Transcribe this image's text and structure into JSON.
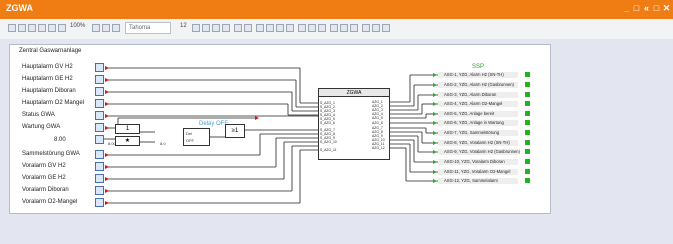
{
  "window": {
    "title": "ZGWA",
    "controls": [
      "_",
      "□",
      "«",
      "□",
      "✕"
    ]
  },
  "toolbar": {
    "zoom": "100%",
    "font": "Tahoma",
    "font_size": "12"
  },
  "diagram": {
    "title": "Zentral Gaswarnanlage",
    "inputs": [
      {
        "label": "Hauptalarm GV H2"
      },
      {
        "label": "Hauptalarm GE H2"
      },
      {
        "label": "Hauptalarm Diboran"
      },
      {
        "label": "Hauptalarm O2 Mangel"
      },
      {
        "label": "Status GWA"
      },
      {
        "label": "Wartung GWA"
      },
      {
        "label": "Sammelstörung GWA"
      },
      {
        "label": "Voralarm GV H2"
      },
      {
        "label": "Voralarm GE H2"
      },
      {
        "label": "Voralarm Diboran"
      },
      {
        "label": "Voralarm O2-Mangel"
      }
    ],
    "const_value": "8.00",
    "const_label": "8.00",
    "and_gate": "1",
    "star_gate": "★",
    "delay": {
      "title": "Delay OFF",
      "value": "8.0",
      "label": "Del",
      "sub": "OFF"
    },
    "or_gate": "≥1",
    "block": {
      "name": "ZGWA",
      "left_pins": [
        "S_AZG_1",
        "S_AZG_2",
        "S_AZG_3",
        "S_AZG_4",
        "S_AZG_5",
        "S_AZG_6",
        "S_AZG_7",
        "S_AZG_8",
        "S_AZG_9",
        "S_AZG_10",
        "S_AZG_11"
      ],
      "right_pins": [
        "AZG_1",
        "AZG_2",
        "AZG_3",
        "AZG_4",
        "AZG_5",
        "AZG_6",
        "AZG_7",
        "AZG_8",
        "AZG_9",
        "AZG_10",
        "AZG_11",
        "AZG_12"
      ]
    },
    "outputs_title": "SSP",
    "outputs": [
      {
        "label": "ASG-1, YZG, Alarm H2 (SN-TH)"
      },
      {
        "label": "ASG-2, YZG, Alarm H2 (Gasbrunnen)"
      },
      {
        "label": "ASG-3, YZG, Alarm Diboran"
      },
      {
        "label": "ASG-4, YZG, Alarm O2-Mangel"
      },
      {
        "label": "ASG-5, YZG, Anlage bereit"
      },
      {
        "label": "ASG-6, YZG, Anlage in Wartung"
      },
      {
        "label": "ASG-7, YZG, Sammelstörung"
      },
      {
        "label": "ASG-8, YZG, Voralarm H2 (SN-TH)"
      },
      {
        "label": "ASG-9, YZG, Voralarm H2 (Gasbrunnen)"
      },
      {
        "label": "ASG-10, YZG, Voralarm Diboran"
      },
      {
        "label": "ASG-11, YZG, Voralarm O2-Mangel"
      },
      {
        "label": "ASG-12, YZG, Sammelalarm"
      }
    ]
  },
  "colors": {
    "titlebar": "#f07d14",
    "workspace": "#e3e6f0",
    "output_led": "#21b121",
    "wire_red": "#d01818"
  }
}
